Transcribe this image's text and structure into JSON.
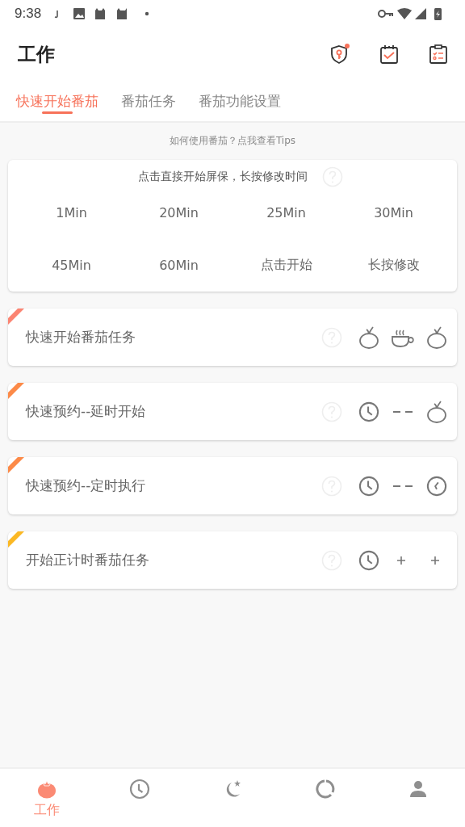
{
  "status_bar": {
    "time": "9:38"
  },
  "header": {
    "title": "工作"
  },
  "tabs": [
    {
      "label": "快速开始番茄",
      "selected": true
    },
    {
      "label": "番茄任务",
      "selected": false
    },
    {
      "label": "番茄功能设置",
      "selected": false
    }
  ],
  "tips_link": "如何使用番茄？点我查看Tips",
  "quick_card": {
    "hint": "点击直接开始屏保，长按修改时间",
    "options": [
      "1Min",
      "20Min",
      "25Min",
      "30Min",
      "45Min",
      "60Min",
      "点击开始",
      "长按修改"
    ]
  },
  "modes": [
    {
      "label": "快速开始番茄任务",
      "color": "#fb8472",
      "kind": "tomato-break"
    },
    {
      "label": "快速预约--延时开始",
      "color": "#fc8a48",
      "kind": "delay"
    },
    {
      "label": "快速预约--定时执行",
      "color": "#fc8a48",
      "kind": "schedule"
    },
    {
      "label": "开始正计时番茄任务",
      "color": "#fbb824",
      "kind": "count-up"
    }
  ],
  "bottom_nav": [
    {
      "kind": "tomato",
      "label": "工作",
      "selected": true
    },
    {
      "kind": "clock",
      "selected": false
    },
    {
      "kind": "moon",
      "selected": false
    },
    {
      "kind": "ring",
      "selected": false
    },
    {
      "kind": "person",
      "selected": false
    }
  ]
}
